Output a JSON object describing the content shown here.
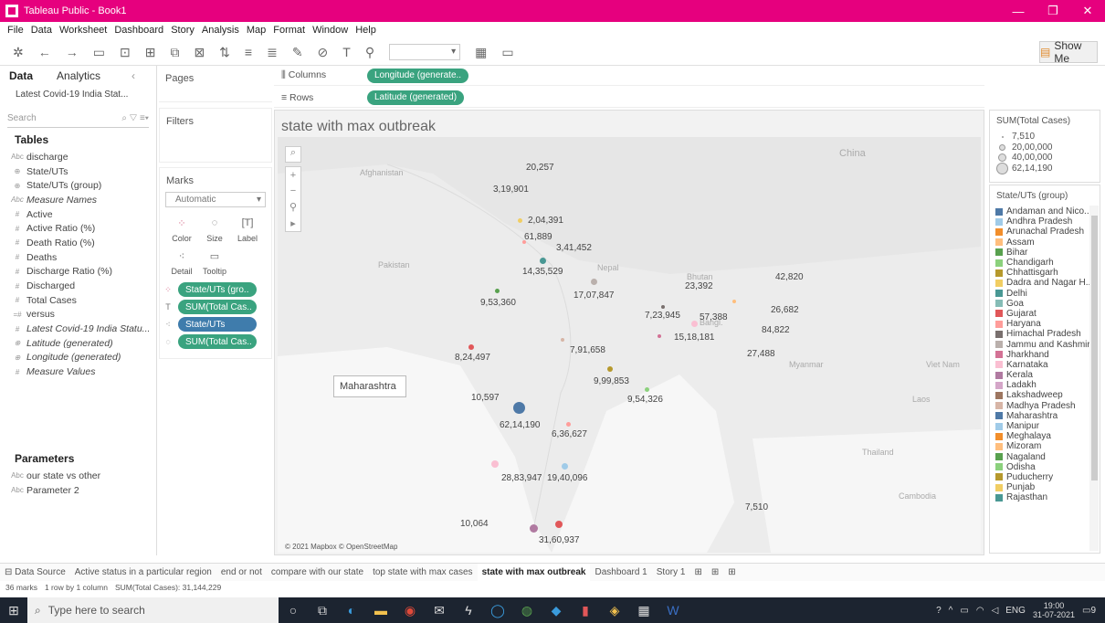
{
  "window": {
    "title": "Tableau Public - Book1"
  },
  "menu": [
    "File",
    "Data",
    "Worksheet",
    "Dashboard",
    "Story",
    "Analysis",
    "Map",
    "Format",
    "Window",
    "Help"
  ],
  "toolbar": {
    "show_me": "Show Me"
  },
  "data_pane": {
    "tab_data": "Data",
    "tab_analytics": "Analytics",
    "datasource": "Latest Covid-19 India Stat...",
    "search_placeholder": "Search",
    "tables_header": "Tables",
    "fields": [
      {
        "icon": "Abc",
        "name": "discharge",
        "italic": false
      },
      {
        "icon": "⊕",
        "name": "State/UTs",
        "italic": false
      },
      {
        "icon": "⊕",
        "name": "State/UTs (group)",
        "italic": false
      },
      {
        "icon": "Abc",
        "name": "Measure Names",
        "italic": true
      },
      {
        "icon": "#",
        "name": "Active",
        "italic": false
      },
      {
        "icon": "#",
        "name": "Active Ratio (%)",
        "italic": false
      },
      {
        "icon": "#",
        "name": "Death Ratio (%)",
        "italic": false
      },
      {
        "icon": "#",
        "name": "Deaths",
        "italic": false
      },
      {
        "icon": "#",
        "name": "Discharge Ratio (%)",
        "italic": false
      },
      {
        "icon": "#",
        "name": "Discharged",
        "italic": false
      },
      {
        "icon": "#",
        "name": "Total Cases",
        "italic": false
      },
      {
        "icon": "=#",
        "name": "versus",
        "italic": false
      },
      {
        "icon": "#",
        "name": "Latest Covid-19 India Statu...",
        "italic": true
      },
      {
        "icon": "⊕",
        "name": "Latitude (generated)",
        "italic": true
      },
      {
        "icon": "⊕",
        "name": "Longitude (generated)",
        "italic": true
      },
      {
        "icon": "#",
        "name": "Measure Values",
        "italic": true
      }
    ],
    "parameters_header": "Parameters",
    "parameters": [
      {
        "icon": "Abc",
        "name": "our state vs other"
      },
      {
        "icon": "Abc",
        "name": "Parameter 2"
      }
    ]
  },
  "shelves": {
    "pages": "Pages",
    "filters": "Filters",
    "columns_label": "Columns",
    "rows_label": "Rows",
    "columns_pill": "Longitude (generate..",
    "rows_pill": "Latitude (generated)"
  },
  "marks": {
    "title": "Marks",
    "type": "Automatic",
    "buttons": [
      "Color",
      "Size",
      "Label",
      "Detail",
      "Tooltip"
    ],
    "pills": [
      {
        "text": "State/UTs (gro..",
        "color": "green"
      },
      {
        "text": "SUM(Total Cas..",
        "color": "green"
      },
      {
        "text": "State/UTs",
        "color": "blue"
      },
      {
        "text": "SUM(Total Cas..",
        "color": "green"
      }
    ]
  },
  "view": {
    "title": "state with max outbreak",
    "tooltip": "Maharashtra",
    "copyright": "© 2021 Mapbox © OpenStreetMap",
    "geo_labels": [
      "China",
      "Afghanistan",
      "Pakistan",
      "Nepal",
      "Bhutan",
      "Bangl.",
      "Myanmar",
      "Laos",
      "Thailand",
      "Viet Nam",
      "Cambodia"
    ],
    "case_labels": [
      "20,257",
      "3,19,901",
      "2,04,391",
      "61,889",
      "3,41,452",
      "14,35,529",
      "42,820",
      "23,392",
      "17,07,847",
      "9,53,360",
      "26,682",
      "7,23,945",
      "57,388",
      "84,822",
      "15,18,181",
      "27,488",
      "7,91,658",
      "8,24,497",
      "9,99,853",
      "10,597",
      "9,54,326",
      "62,14,190",
      "6,36,627",
      "28,83,947",
      "19,40,096",
      "7,510",
      "10,064",
      "31,60,937"
    ]
  },
  "size_legend": {
    "title": "SUM(Total Cases)",
    "items": [
      "7,510",
      "20,00,000",
      "40,00,000",
      "62,14,190"
    ]
  },
  "color_legend": {
    "title": "State/UTs (group)",
    "items": [
      {
        "name": "Andaman and Nico...",
        "color": "#4e79a7"
      },
      {
        "name": "Andhra Pradesh",
        "color": "#a0cbe8"
      },
      {
        "name": "Arunachal Pradesh",
        "color": "#f28e2b"
      },
      {
        "name": "Assam",
        "color": "#ffbe7d"
      },
      {
        "name": "Bihar",
        "color": "#59a14f"
      },
      {
        "name": "Chandigarh",
        "color": "#8cd17d"
      },
      {
        "name": "Chhattisgarh",
        "color": "#b6992d"
      },
      {
        "name": "Dadra and Nagar H...",
        "color": "#f1ce63"
      },
      {
        "name": "Delhi",
        "color": "#499894"
      },
      {
        "name": "Goa",
        "color": "#86bcb6"
      },
      {
        "name": "Gujarat",
        "color": "#e15759"
      },
      {
        "name": "Haryana",
        "color": "#ff9d9a"
      },
      {
        "name": "Himachal Pradesh",
        "color": "#79706e"
      },
      {
        "name": "Jammu and Kashmir",
        "color": "#bab0ac"
      },
      {
        "name": "Jharkhand",
        "color": "#d37295"
      },
      {
        "name": "Karnataka",
        "color": "#fabfd2"
      },
      {
        "name": "Kerala",
        "color": "#b07aa1"
      },
      {
        "name": "Ladakh",
        "color": "#d4a6c8"
      },
      {
        "name": "Lakshadweep",
        "color": "#9d7660"
      },
      {
        "name": "Madhya Pradesh",
        "color": "#d7b5a6"
      },
      {
        "name": "Maharashtra",
        "color": "#4e79a7"
      },
      {
        "name": "Manipur",
        "color": "#a0cbe8"
      },
      {
        "name": "Meghalaya",
        "color": "#f28e2b"
      },
      {
        "name": "Mizoram",
        "color": "#ffbe7d"
      },
      {
        "name": "Nagaland",
        "color": "#59a14f"
      },
      {
        "name": "Odisha",
        "color": "#8cd17d"
      },
      {
        "name": "Puducherry",
        "color": "#b6992d"
      },
      {
        "name": "Punjab",
        "color": "#f1ce63"
      },
      {
        "name": "Rajasthan",
        "color": "#499894"
      }
    ]
  },
  "sheet_tabs": {
    "data_source": "Data Source",
    "tabs": [
      "Active status in a particular region",
      "end or not",
      "compare with our state",
      "top state with max cases",
      "state with max outbreak",
      "Dashboard 1",
      "Story 1"
    ],
    "active": "state with max outbreak"
  },
  "status": {
    "marks": "36 marks",
    "rows": "1 row by 1 column",
    "sum": "SUM(Total Cases): 31,144,229"
  },
  "taskbar": {
    "search_placeholder": "Type here to search",
    "time": "19:00",
    "date": "31-07-2021",
    "lang": "ENG",
    "notif": "9"
  }
}
